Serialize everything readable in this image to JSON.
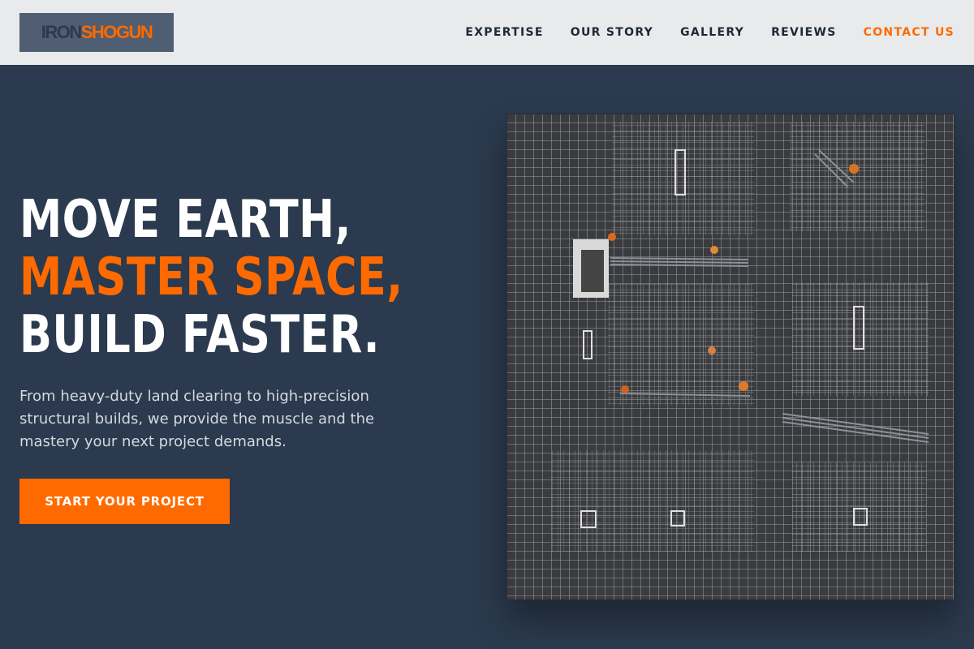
{
  "logo": {
    "part1": "IRON",
    "part2": "SHOGUN"
  },
  "nav": {
    "items": [
      "EXPERTISE",
      "OUR STORY",
      "GALLERY",
      "REVIEWS"
    ],
    "contact": "CONTACT US"
  },
  "hero": {
    "line1": "MOVE EARTH,",
    "line2": "MASTER SPACE,",
    "line3": "BUILD FASTER.",
    "description": "From heavy-duty land clearing to high-precision structural builds, we provide the muscle and the mastery your next project demands.",
    "cta": "START YOUR PROJECT"
  },
  "colors": {
    "accent": "#ff6a00",
    "background": "#2b3a4e",
    "header": "#e9eaec"
  },
  "image": {
    "subject": "aerial view of workers laying steel rebar mesh on a construction site"
  }
}
